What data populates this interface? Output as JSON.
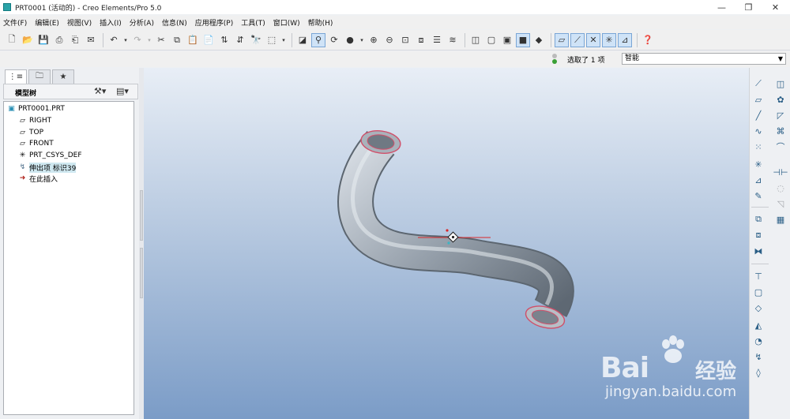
{
  "window": {
    "title": "PRT0001 (活动的) - Creo Elements/Pro 5.0"
  },
  "menu": [
    "文件(F)",
    "编辑(E)",
    "视图(V)",
    "插入(I)",
    "分析(A)",
    "信息(N)",
    "应用程序(P)",
    "工具(T)",
    "窗口(W)",
    "帮助(H)"
  ],
  "status": {
    "selected_text": "选取了 1 项",
    "filter_value": "智能"
  },
  "tree": {
    "header": "模型树",
    "items": [
      {
        "label": "PRT0001.PRT",
        "icon": "part-icon"
      },
      {
        "label": "RIGHT",
        "icon": "datum-plane-icon"
      },
      {
        "label": "TOP",
        "icon": "datum-plane-icon"
      },
      {
        "label": "FRONT",
        "icon": "datum-plane-icon"
      },
      {
        "label": "PRT_CSYS_DEF",
        "icon": "coordinate-system-icon"
      },
      {
        "label": "伸出项 标识39",
        "icon": "sweep-feature-icon"
      },
      {
        "label": "在此插入",
        "icon": "insert-here-icon"
      }
    ]
  },
  "watermark": {
    "brand": "Bai",
    "brand2": "经验",
    "url": "jingyan.baidu.com"
  },
  "colors": {
    "viewport_top": "#e8eef6",
    "viewport_bottom": "#7b9cc7",
    "tree_highlight": "#cfe8f0",
    "pipe": "#9aa3ad"
  }
}
